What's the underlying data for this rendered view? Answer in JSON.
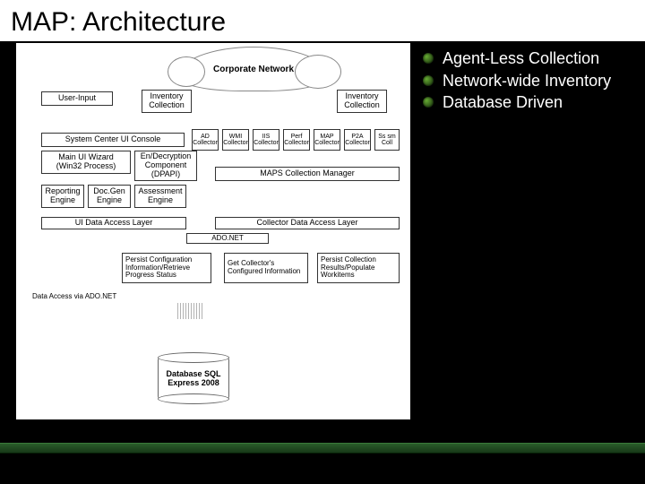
{
  "title": "MAP: Architecture",
  "diagram": {
    "cloud": "Corporate Network",
    "user_input": "User-Input",
    "inv_coll_left": "Inventory\nCollection",
    "inv_coll_right": "Inventory\nCollection",
    "sccm_ui": "System Center UI Console",
    "main_ui": "Main UI Wizard\n(Win32 Process)",
    "encrypt": "En/Decryption\nComponent\n(DPAPI)",
    "reporting": "Reporting\nEngine",
    "docgen": "Doc.Gen\nEngine",
    "assessment": "Assessment\nEngine",
    "tiny1": "AD\nCollector",
    "tiny2": "WMI\nCollector",
    "tiny3": "IIS\nCollector",
    "tiny4": "Perf\nCollector",
    "tiny5": "MAP\nCollector",
    "tiny6": "P2A\nCollector",
    "tiny7": "Ss sm\nColl",
    "maps_coll_mgr": "MAPS Collection Manager",
    "ui_data_access": "UI Data Access Layer",
    "coll_data_access": "Collector Data Access Layer",
    "ado": "ADO.NET",
    "persist_config": "Persist Configuration\nInformation/Retrieve\nProgress Status",
    "get_collectors": "Get Collector's\nConfigured Information",
    "persist_results": "Persist Collection\nResults/Populate\nWorkitems",
    "data_via_ado": "Data Access via ADO.NET",
    "database": "Database\nSQL Express\n2008"
  },
  "bullets": [
    "Agent-Less Collection",
    "Network-wide Inventory",
    "Database Driven"
  ]
}
